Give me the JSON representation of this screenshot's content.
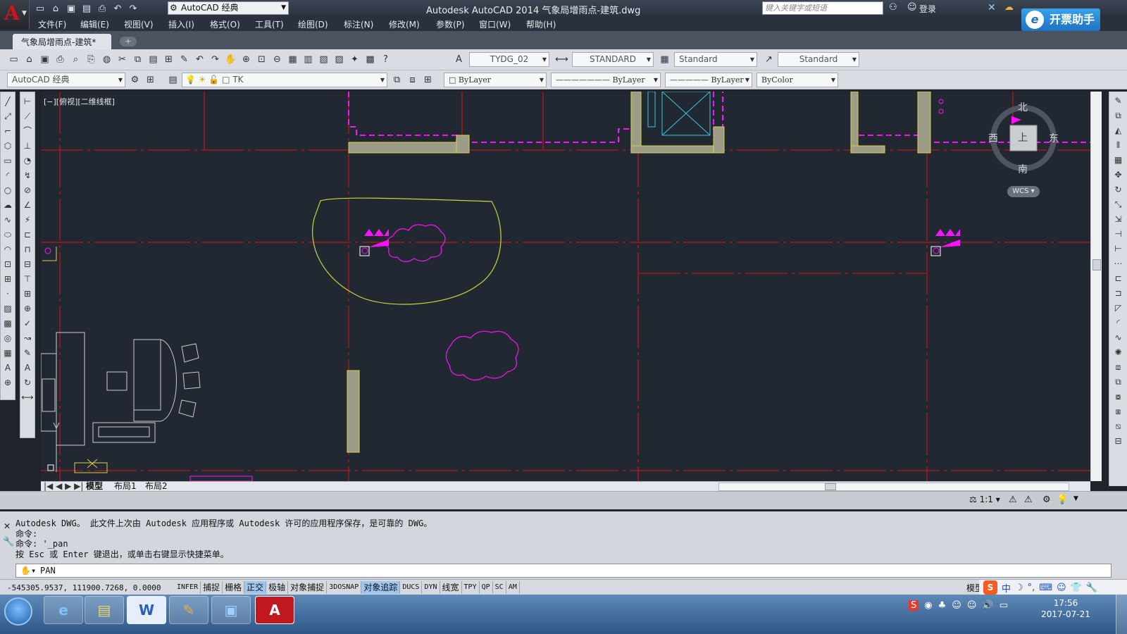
{
  "window": {
    "title": "Autodesk AutoCAD 2014    气象局增雨点-建筑.dwg",
    "workspace": "AutoCAD 经典",
    "search_placeholder": "键入关键字或短语",
    "login": "登录",
    "badge": "开票助手"
  },
  "menu": [
    "文件(F)",
    "编辑(E)",
    "视图(V)",
    "插入(I)",
    "格式(O)",
    "工具(T)",
    "绘图(D)",
    "标注(N)",
    "修改(M)",
    "参数(P)",
    "窗口(W)",
    "帮助(H)"
  ],
  "file_tab": {
    "label": "气象局增雨点-建筑*"
  },
  "toolbar1": {
    "text_style": "TYDG_02",
    "dim_style": "STANDARD",
    "table_style": "Standard",
    "mleader_style": "Standard"
  },
  "toolbar2": {
    "workspace": "AutoCAD 经典",
    "layer": "TK",
    "color": "ByLayer",
    "linetype": "ByLayer",
    "lineweight": "ByLayer",
    "plotstyle": "ByColor"
  },
  "viewport": {
    "label": "[−][俯视][二维线框]"
  },
  "viewcube": {
    "north": "北",
    "south": "南",
    "west": "西",
    "east": "东",
    "top": "上",
    "wcs": "WCS"
  },
  "layout_tabs": [
    "模型",
    "布局1",
    "布局2"
  ],
  "annotation_scale": "1:1",
  "command": {
    "history": [
      "Autodesk DWG。  此文件上次由 Autodesk 应用程序或 Autodesk 许可的应用程序保存，是可靠的 DWG。",
      "命令:",
      "命令: '_pan",
      "按 Esc 或 Enter 键退出，或单击右键显示快捷菜单。"
    ],
    "current": "PAN"
  },
  "status": {
    "coords": "-545305.9537, 111900.7268, 0.0000",
    "toggles": [
      {
        "label": "INFER",
        "on": false
      },
      {
        "label": "捕捉",
        "on": false
      },
      {
        "label": "栅格",
        "on": false
      },
      {
        "label": "正交",
        "on": true
      },
      {
        "label": "极轴",
        "on": false
      },
      {
        "label": "对象捕捉",
        "on": false
      },
      {
        "label": "3DOSNAP",
        "on": false
      },
      {
        "label": "对象追踪",
        "on": true
      },
      {
        "label": "DUCS",
        "on": false
      },
      {
        "label": "DYN",
        "on": false
      },
      {
        "label": "线宽",
        "on": false
      },
      {
        "label": "TPY",
        "on": false
      },
      {
        "label": "QP",
        "on": false
      },
      {
        "label": "SC",
        "on": false
      },
      {
        "label": "AM",
        "on": false
      }
    ],
    "model": "模型",
    "ime_lang": "中"
  },
  "taskbar": {
    "apps": [
      "ie-icon",
      "explorer-icon",
      "word-icon",
      "notes-icon",
      "photo-icon",
      "autocad-icon"
    ],
    "time": "17:56",
    "date": "2017-07-21"
  },
  "colors": {
    "canvas": "#222831",
    "axis_red": "#e01010",
    "magenta": "#ff10ff",
    "yellow_green": "#c8d63a",
    "wall_fill": "#9b9b86"
  }
}
